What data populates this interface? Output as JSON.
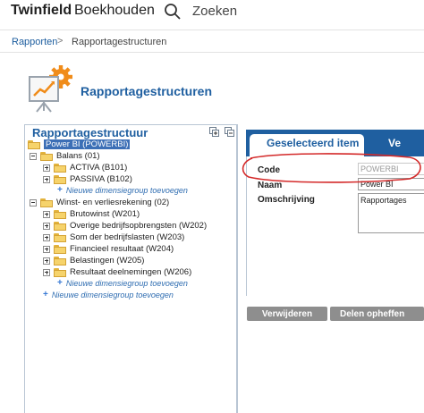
{
  "header": {
    "brand": "Twinfield",
    "module": "Boekhouden",
    "search_label": "Zoeken"
  },
  "breadcrumb": {
    "link": "Rapporten",
    "separator": ">",
    "current": "Rapportagestructuren"
  },
  "page": {
    "title": "Rapportagestructuren"
  },
  "tree": {
    "title": "Rapportagestructuur",
    "root": "Power BI (POWERBI)",
    "nodes": [
      {
        "label": "Balans (01)",
        "level": 1,
        "toggle": "minus"
      },
      {
        "label": "ACTIVA (B101)",
        "level": 2,
        "toggle": "plus"
      },
      {
        "label": "PASSIVA (B102)",
        "level": 2,
        "toggle": "plus"
      },
      {
        "label": "Winst- en verliesrekening (02)",
        "level": 1,
        "toggle": "minus"
      },
      {
        "label": "Brutowinst (W201)",
        "level": 2,
        "toggle": "plus"
      },
      {
        "label": "Overige bedrijfsopbrengsten (W202)",
        "level": 2,
        "toggle": "plus"
      },
      {
        "label": "Som der bedrijfslasten (W203)",
        "level": 2,
        "toggle": "plus"
      },
      {
        "label": "Financieel resultaat (W204)",
        "level": 2,
        "toggle": "plus"
      },
      {
        "label": "Belastingen (W205)",
        "level": 2,
        "toggle": "plus"
      },
      {
        "label": "Resultaat deelnemingen (W206)",
        "level": 2,
        "toggle": "plus"
      }
    ],
    "add_link": "Nieuwe dimensiegroup toevoegen"
  },
  "detail": {
    "tab_selected": "Geselecteerd item",
    "tab_second": "Ve",
    "fields": {
      "code_label": "Code",
      "code_value": "POWERBI",
      "name_label": "Naam",
      "name_value": "Power BI",
      "description_label": "Omschrijving",
      "description_value": "Rapportages"
    }
  },
  "buttons": {
    "delete": "Verwijderen",
    "unlink": "Delen opheffen"
  },
  "colors": {
    "accent": "#1f5fa0",
    "annotation": "#d42a2a",
    "folder": "#f6d36b",
    "button": "#8e8e8e"
  },
  "icons": {
    "search": "search-icon",
    "page": "report-structure-icon",
    "folder": "folder-icon"
  }
}
